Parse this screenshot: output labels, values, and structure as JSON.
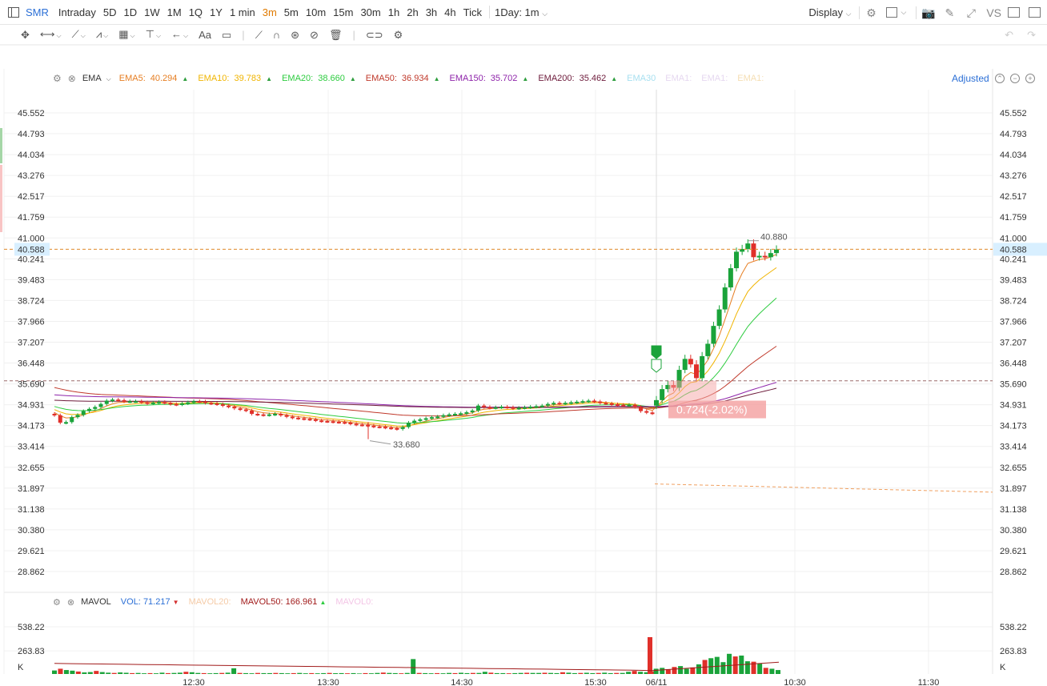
{
  "toolbar": {
    "symbol": "SMR",
    "timeframes": [
      "Intraday",
      "5D",
      "1D",
      "1W",
      "1M",
      "1Q",
      "1Y",
      "1 min",
      "3m",
      "5m",
      "10m",
      "15m",
      "30m",
      "1h",
      "2h",
      "3h",
      "4h",
      "Tick"
    ],
    "active_timeframe": "3m",
    "session": "1Day: 1m",
    "display": "Display",
    "vs": "VS",
    "right_icons": [
      "gear-icon",
      "layout-icon",
      "camera-icon",
      "pen-icon",
      "fullscreen-icon",
      "sidebar-icon",
      "panel-icon"
    ]
  },
  "drawbar": {
    "tools": [
      "crosshair-icon",
      "line-tool-icon",
      "trend-tool-icon",
      "wave-tool-icon",
      "fib-tool-icon",
      "horizontal-line-icon",
      "arrow-tool-icon",
      "text-tool-icon",
      "ruler-icon",
      "magnet-icon",
      "link-icon",
      "hide-icon",
      "trash-icon",
      "eye-icon",
      "settings-icon"
    ],
    "text_tool_label": "Aa"
  },
  "legend": {
    "indicator": "EMA",
    "items": [
      {
        "name": "EMA5:",
        "value": "40.294",
        "color": "#e67e22",
        "arrow": "▲"
      },
      {
        "name": "EMA10:",
        "value": "39.783",
        "color": "#f0b400",
        "arrow": "▲"
      },
      {
        "name": "EMA20:",
        "value": "38.660",
        "color": "#2ecc40",
        "arrow": "▲"
      },
      {
        "name": "EMA50:",
        "value": "36.934",
        "color": "#c0392b",
        "arrow": "▲"
      },
      {
        "name": "EMA150:",
        "value": "35.702",
        "color": "#8e24aa",
        "arrow": "▲"
      },
      {
        "name": "EMA200:",
        "value": "35.462",
        "color": "#6d1b3b",
        "arrow": "▲"
      }
    ],
    "faded": [
      "EMA30",
      "EMA1:",
      "EMA1:",
      "EMA1:"
    ],
    "adjusted": "Adjusted"
  },
  "price_axis": {
    "ticks": [
      "45.552",
      "44.793",
      "44.034",
      "43.276",
      "42.517",
      "41.759",
      "41.000",
      "40.241",
      "39.483",
      "38.724",
      "37.966",
      "37.207",
      "36.448",
      "35.690",
      "34.931",
      "34.173",
      "33.414",
      "32.655",
      "31.897",
      "31.138",
      "30.380",
      "29.621",
      "28.862"
    ],
    "current_price": "40.588",
    "high_label": "40.880",
    "low_label": "33.680",
    "measure_label": "0.724(-2.02%)"
  },
  "time_axis": {
    "labels": [
      "12:30",
      "13:30",
      "14:30",
      "15:30",
      "06/11",
      "10:30",
      "11:30"
    ]
  },
  "volume": {
    "indicator": "MAVOL",
    "vol": {
      "name": "VOL:",
      "value": "71.217",
      "arrow": "▼"
    },
    "mavol20": "MAVOL20:",
    "mavol50": {
      "name": "MAVOL50:",
      "value": "166.961",
      "arrow": "▲"
    },
    "mavol0": "MAVOL0:",
    "ticks": [
      "538.22",
      "263.83",
      "K"
    ]
  },
  "chart_data": {
    "type": "candlestick",
    "price_range": [
      28.862,
      45.552
    ],
    "current_price": 40.588,
    "high": 40.88,
    "low": 33.68,
    "day1_close": [
      34.55,
      34.28,
      34.3,
      34.48,
      34.56,
      34.7,
      34.78,
      34.85,
      34.96,
      35.08,
      35.12,
      35.1,
      35.05,
      35.06,
      35.06,
      35.02,
      34.98,
      35.01,
      35.03,
      35.0,
      34.96,
      34.94,
      34.98,
      35.02,
      35.06,
      35.05,
      35.0,
      34.98,
      34.95,
      34.9,
      34.86,
      34.8,
      34.76,
      34.72,
      34.6,
      34.58,
      34.56,
      34.58,
      34.6,
      34.55,
      34.5,
      34.46,
      34.44,
      34.42,
      34.4,
      34.36,
      34.34,
      34.33,
      34.31,
      34.3,
      34.28,
      34.24,
      34.21,
      34.2,
      34.17,
      34.14,
      34.13,
      34.1,
      34.08,
      34.05,
      34.12,
      34.28,
      34.35,
      34.4,
      34.44,
      34.48,
      34.5,
      34.55,
      34.58,
      34.6,
      34.62,
      34.66,
      34.72,
      34.9,
      34.85,
      34.82,
      34.84,
      34.86,
      34.84,
      34.8,
      34.82,
      34.84,
      34.86,
      34.88,
      34.9,
      34.96,
      35.0,
      34.98,
      35.0,
      35.02,
      35.04,
      35.06,
      35.08,
      35.05,
      35.0,
      34.98,
      34.95,
      34.93,
      34.92,
      34.93,
      34.85,
      34.7,
      34.65,
      34.62
    ],
    "day2_close": [
      35.1,
      35.5,
      35.65,
      35.55,
      36.2,
      36.6,
      36.4,
      35.9,
      36.7,
      37.15,
      37.8,
      38.4,
      39.2,
      39.9,
      40.5,
      40.6,
      40.8,
      40.3,
      40.35,
      40.3,
      40.45,
      40.58
    ],
    "volume_bars_k": [
      40,
      60,
      45,
      38,
      28,
      18,
      22,
      35,
      22,
      15,
      12,
      18,
      14,
      10,
      12,
      8,
      10,
      8,
      15,
      10,
      12,
      15,
      25,
      20,
      12,
      10,
      8,
      10,
      12,
      15,
      65,
      12,
      10,
      8,
      12,
      10,
      10,
      12,
      10,
      8,
      10,
      12,
      8,
      10,
      8,
      10,
      12,
      9,
      10,
      8,
      10,
      6,
      10,
      8,
      12,
      16,
      12,
      10,
      8,
      12,
      170,
      12,
      10,
      8,
      10,
      8,
      12,
      10,
      14,
      10,
      12,
      12,
      25,
      15,
      10,
      10,
      8,
      10,
      12,
      14,
      12,
      12,
      14,
      12,
      10,
      20,
      15,
      10,
      12,
      14,
      10,
      12,
      15,
      10,
      12,
      12,
      25,
      35,
      25,
      20,
      30
    ],
    "volume_day2_k": [
      420,
      60,
      70,
      55,
      80,
      90,
      60,
      75,
      110,
      160,
      180,
      195,
      135,
      230,
      200,
      210,
      145,
      140,
      120,
      70,
      60,
      45
    ]
  }
}
